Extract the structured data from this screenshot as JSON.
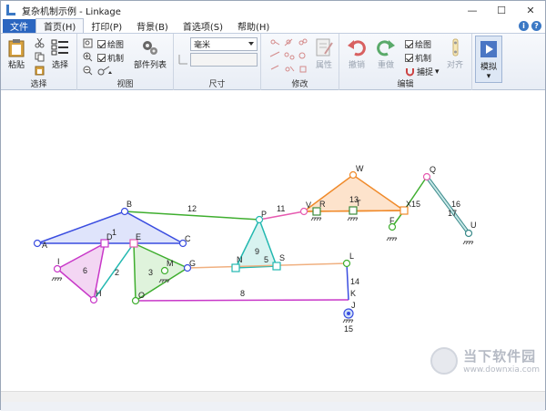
{
  "window": {
    "title": "复杂机制示例 - Linkage",
    "controls": {
      "minimize": "—",
      "maximize": "☐",
      "close": "✕"
    }
  },
  "menu": {
    "file_label": "文件",
    "tabs": [
      {
        "label": "首页(H)",
        "active": true
      },
      {
        "label": "打印(P)",
        "active": false
      },
      {
        "label": "背景(B)",
        "active": false
      },
      {
        "label": "首选项(S)",
        "active": false
      },
      {
        "label": "帮助(H)",
        "active": false
      }
    ]
  },
  "ribbon": {
    "select_group": {
      "label": "选择",
      "paste_label": "粘贴",
      "select_label": "选择"
    },
    "view_group": {
      "label": "视图",
      "draw_label": "绘图",
      "draw_checked": true,
      "mechanism_label": "机制",
      "mechanism_checked": true,
      "parts_list_label": "部件列表"
    },
    "size_group": {
      "label": "尺寸",
      "unit_value": "毫米"
    },
    "modify_group": {
      "label": "修改",
      "properties_label": "属性"
    },
    "edit_group": {
      "label": "编辑",
      "undo_label": "撤销",
      "redo_label": "重做",
      "draw_label": "绘图",
      "draw_checked": true,
      "mechanism_label": "机制",
      "mechanism_checked": true,
      "snap_label": "捕捉",
      "align_label": "对齐"
    },
    "simulate_group": {
      "simulate_label": "模拟"
    }
  },
  "colors": {
    "file_tab": "#2b66c0",
    "blue_link": "#3a4de0",
    "green_link": "#3fae2f",
    "magenta_link": "#c837c8",
    "cyan_link": "#22b8b0",
    "orange_link": "#f08a2a",
    "pink_link": "#e65ab0",
    "teal_link": "#3a8a8a"
  },
  "diagram": {
    "labels": [
      "A",
      "B",
      "C",
      "D",
      "E",
      "1",
      "G",
      "H",
      "I",
      "M",
      "N",
      "O",
      "P",
      "R",
      "S",
      "T",
      "U",
      "V",
      "W",
      "X",
      "Q",
      "L",
      "K",
      "F",
      "J",
      "12",
      "11",
      "13",
      "15",
      "16",
      "17",
      "9",
      "5",
      "6",
      "2",
      "3",
      "8",
      "14",
      "15"
    ]
  },
  "watermark": {
    "brand": "当下软件园",
    "site": "www.downxia.com"
  }
}
